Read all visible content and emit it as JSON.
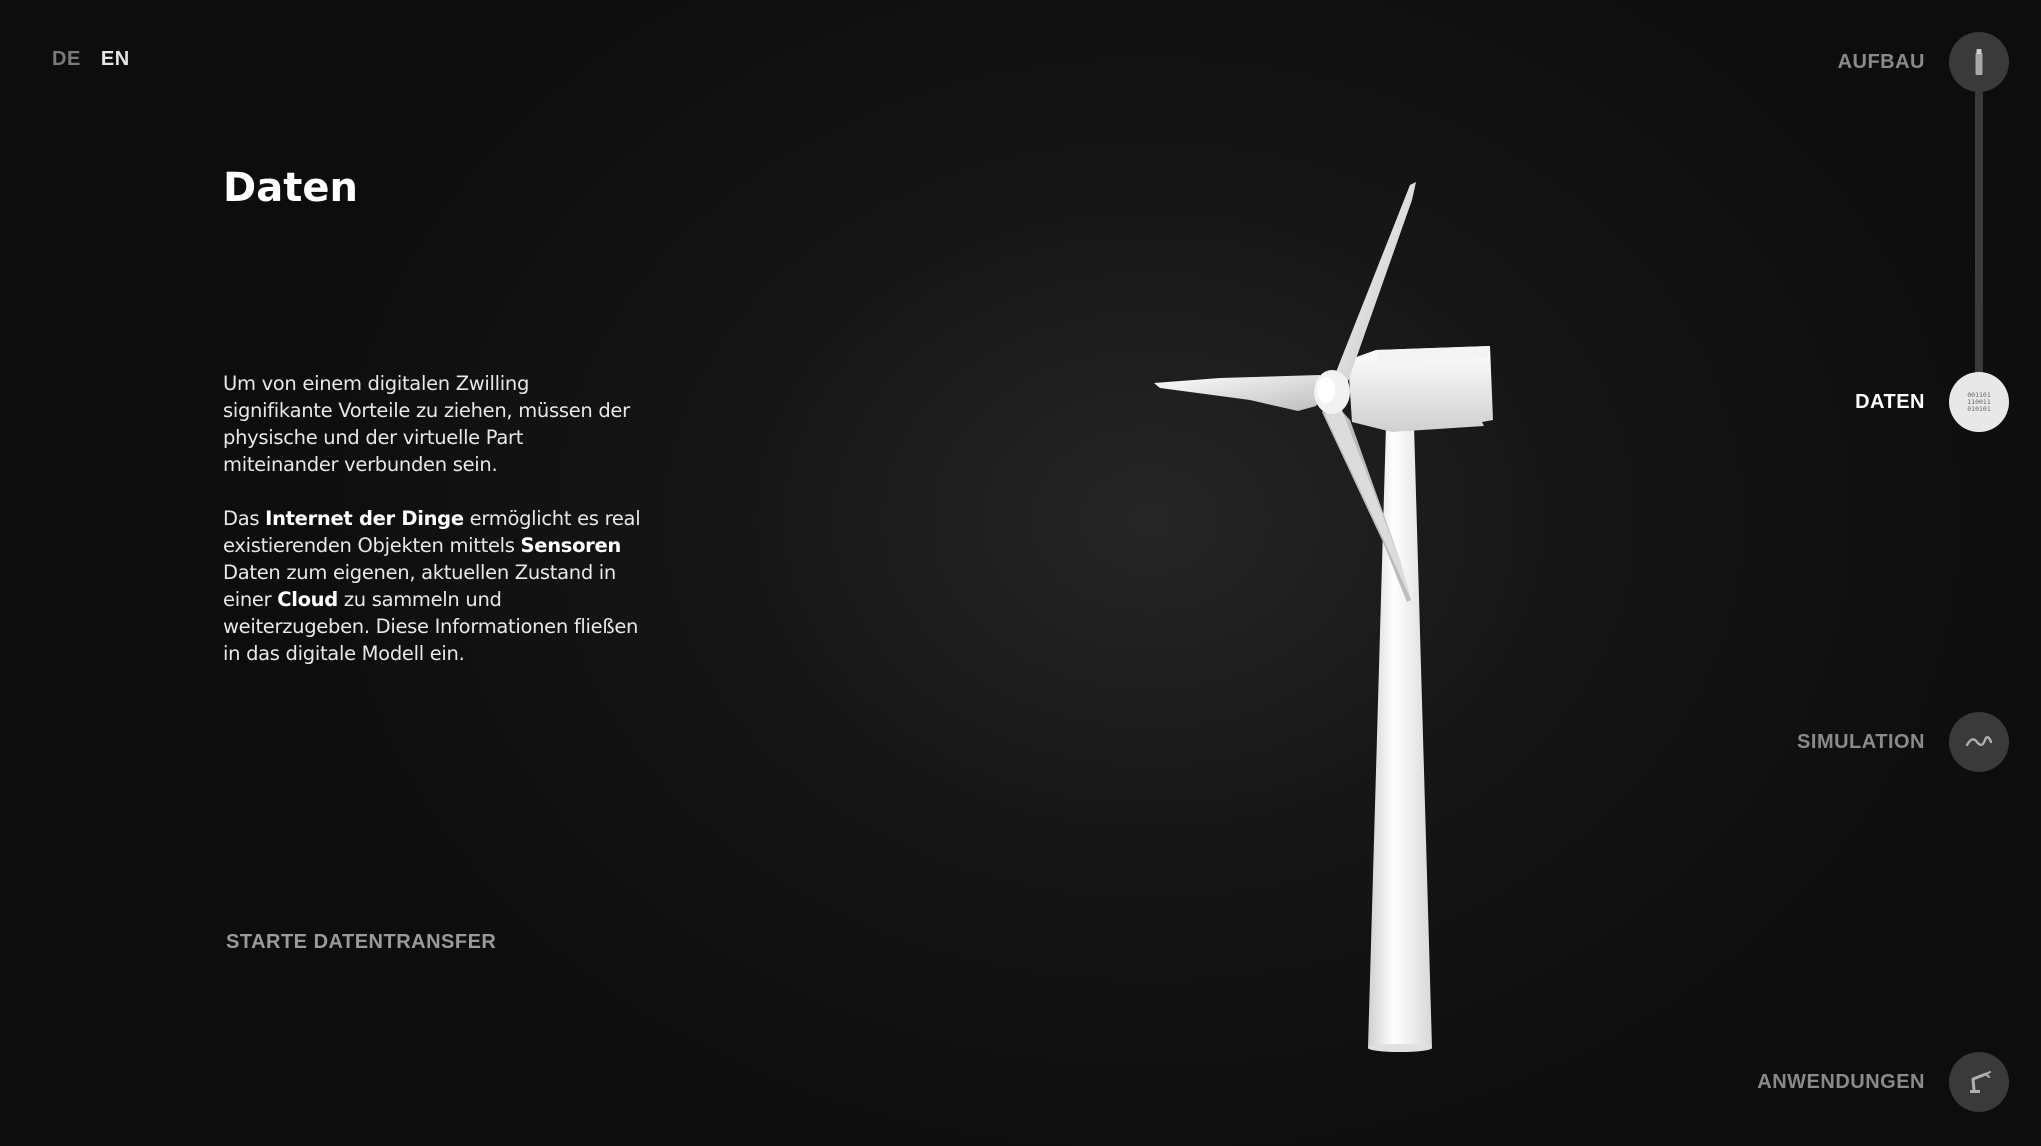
{
  "lang": {
    "de": "DE",
    "en": "EN"
  },
  "content": {
    "title": "Daten",
    "p1": "Um von einem digitalen Zwilling signifikante Vorteile zu ziehen, müssen der physische und der virtuelle Part miteinander verbunden sein.",
    "p2": {
      "a": "Das ",
      "b": "Internet der Dinge",
      "c": " ermöglicht es real existierenden Objekten mittels ",
      "d": "Sensoren",
      "e": " Daten zum eigenen, aktuellen Zustand in einer ",
      "f": "Cloud",
      "g": " zu sammeln und weiterzugeben. Diese Informationen fließen in das digitale Modell ein."
    },
    "start_button": "STARTE DATENTRANSFER"
  },
  "nav": {
    "items": [
      {
        "label": "AUFBAU",
        "icon": "tower-icon"
      },
      {
        "label": "DATEN",
        "icon": "binary-data-icon",
        "active": true
      },
      {
        "label": "SIMULATION",
        "icon": "wave-icon"
      },
      {
        "label": "ANWENDUNGEN",
        "icon": "robot-arm-icon"
      }
    ],
    "binary_lines": [
      "001101",
      "110011",
      "010101"
    ]
  }
}
